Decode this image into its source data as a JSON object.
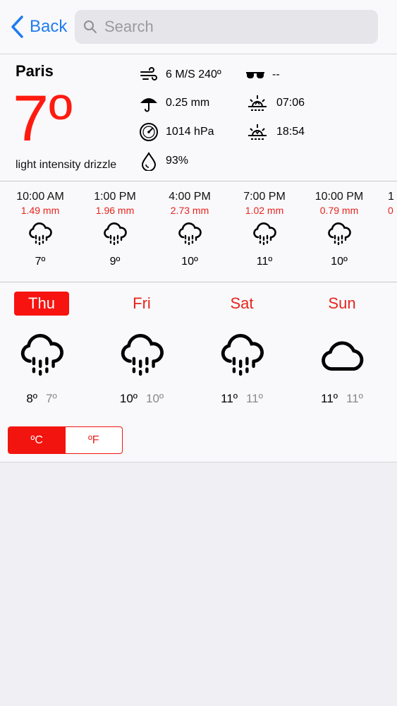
{
  "nav": {
    "back_label": "Back",
    "search_placeholder": "Search"
  },
  "current": {
    "city": "Paris",
    "temperature": "7º",
    "description": "light intensity drizzle",
    "wind": "6 M/S 240º",
    "rain": "0.25 mm",
    "pressure": "1014 hPa",
    "humidity": "93%",
    "uv": "--",
    "sunrise": "07:06",
    "sunset": "18:54"
  },
  "hourly": [
    {
      "time": "10:00 AM",
      "precip": "1.49 mm",
      "temp": "7º",
      "icon": "rain-cloud-icon"
    },
    {
      "time": "1:00 PM",
      "precip": "1.96 mm",
      "temp": "9º",
      "icon": "rain-cloud-icon"
    },
    {
      "time": "4:00 PM",
      "precip": "2.73 mm",
      "temp": "10º",
      "icon": "rain-cloud-icon"
    },
    {
      "time": "7:00 PM",
      "precip": "1.02 mm",
      "temp": "11º",
      "icon": "rain-cloud-icon"
    },
    {
      "time": "10:00 PM",
      "precip": "0.79 mm",
      "temp": "10º",
      "icon": "rain-cloud-icon"
    },
    {
      "time": "1",
      "precip": "0"
    }
  ],
  "daily": [
    {
      "day": "Thu",
      "high": "8º",
      "low": "7º",
      "icon": "rain-cloud-icon",
      "selected": true
    },
    {
      "day": "Fri",
      "high": "10º",
      "low": "10º",
      "icon": "rain-cloud-icon"
    },
    {
      "day": "Sat",
      "high": "11º",
      "low": "11º",
      "icon": "rain-cloud-icon"
    },
    {
      "day": "Sun",
      "high": "11º",
      "low": "11º",
      "icon": "cloud-icon"
    }
  ],
  "units": {
    "celsius": "ºC",
    "fahrenheit": "ºF",
    "selected": "celsius"
  },
  "colors": {
    "accent": "#f2140f",
    "link": "#1f7cf0"
  }
}
